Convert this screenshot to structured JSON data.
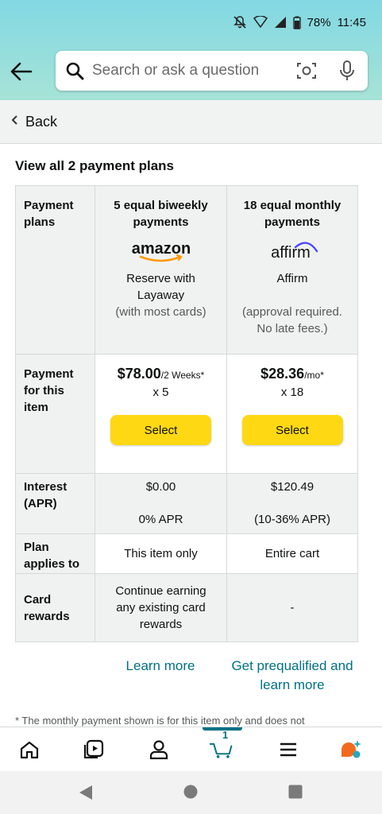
{
  "status_bar": {
    "battery": "78%",
    "time": "11:45"
  },
  "search": {
    "placeholder": "Search or ask a question"
  },
  "back_bar": {
    "label": "Back"
  },
  "heading": "View all 2 payment plans",
  "table": {
    "row_labels": {
      "plans": "Payment plans",
      "payment": "Payment for this item",
      "interest": "Interest (APR)",
      "applies": "Plan applies to",
      "rewards": "Card rewards"
    },
    "plans": [
      {
        "title": "5 equal biweekly payments",
        "logo": "amazon",
        "provider_line": "Reserve with Layaway",
        "note": "(with most cards)",
        "price": "$78.00",
        "price_unit": "/2 Weeks*",
        "count": "x 5",
        "button": "Select",
        "interest": "$0.00",
        "apr": "0% APR",
        "applies_to": "This item only",
        "rewards": "Continue earning any existing card rewards"
      },
      {
        "title": "18 equal monthly payments",
        "logo": "affirm",
        "provider_line": "Affirm",
        "note": "(approval required. No late fees.)",
        "price": "$28.36",
        "price_unit": "/mo*",
        "count": "x 18",
        "button": "Select",
        "interest": "$120.49",
        "apr": "(10-36% APR)",
        "applies_to": "Entire cart",
        "rewards": "-"
      }
    ]
  },
  "links": {
    "learn_more": "Learn more",
    "prequalify": "Get prequalified and learn more"
  },
  "footnote": "*  The monthly payment shown is for this item only and does not",
  "bottom_nav": {
    "cart_count": "1"
  },
  "colors": {
    "accent": "#007185",
    "button": "#ffd814",
    "header": "#82d8e3"
  }
}
